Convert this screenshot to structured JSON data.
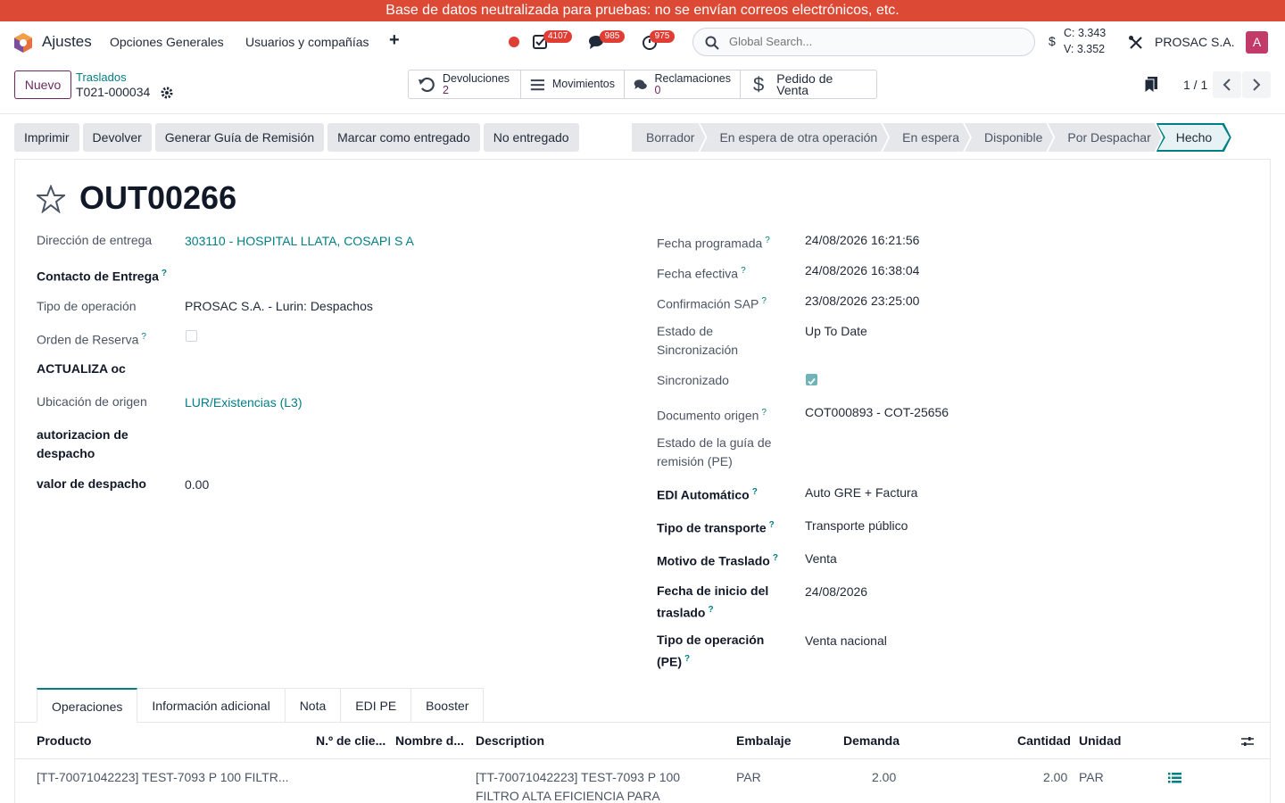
{
  "banner": "Base de datos neutralizada para pruebas: no se envían correos electrónicos, etc.",
  "navbar": {
    "app_name": "Ajustes",
    "menus": [
      "Opciones Generales",
      "Usuarios y compañías"
    ],
    "badges": {
      "activities": "4107",
      "messages": "985",
      "timers": "975"
    },
    "search_placeholder": "Global Search...",
    "currency_c": "C: 3.343",
    "currency_v": "V: 3.352",
    "currency_symbol": "$",
    "company": "PROSAC S.A.",
    "avatar_letter": "A",
    "accent": "#017e84",
    "brand": "#6b2a5f"
  },
  "control": {
    "new_label": "Nuevo",
    "breadcrumb_parent": "Traslados",
    "breadcrumb_current": "T021-000034",
    "smart_buttons": [
      {
        "label": "Devoluciones",
        "count": "2",
        "icon": "undo-icon"
      },
      {
        "label": "Movimientos",
        "count": "",
        "icon": "list-icon"
      },
      {
        "label": "Reclamaciones",
        "count": "0",
        "icon": "comments-icon"
      },
      {
        "label": "Pedido de Venta",
        "count": "",
        "icon": "dollar-icon"
      }
    ],
    "pager": "1 / 1"
  },
  "actions": [
    "Imprimir",
    "Devolver",
    "Generar Guía de Remisión",
    "Marcar como entregado",
    "No entregado"
  ],
  "statusbar": [
    "Borrador",
    "En espera de otra operación",
    "En espera",
    "Disponible",
    "Por Despachar",
    "Hecho"
  ],
  "record": {
    "title": "OUT00266",
    "left_fields": [
      {
        "label": "Dirección de entrega",
        "value": "303110 - HOSPITAL LLATA, COSAPI S A"
      },
      {
        "label": "Contacto de Entrega",
        "value": ""
      },
      {
        "label": "Tipo de operación",
        "value": "PROSAC S.A. - Lurin: Despachos"
      },
      {
        "label": "Orden de Reserva",
        "value": ""
      },
      {
        "label": "ACTUALIZA oc",
        "value": ""
      },
      {
        "label": "Ubicación de origen",
        "value": "LUR/Existencias (L3)"
      },
      {
        "label": "autorizacion de despacho",
        "value": ""
      },
      {
        "label": "valor de despacho",
        "value": "0.00"
      }
    ],
    "right_fields": [
      {
        "label": "Fecha programada",
        "value": "24/08/2026 16:21:56"
      },
      {
        "label": "Fecha efectiva",
        "value": "24/08/2026 16:38:04"
      },
      {
        "label": "Confirmación SAP",
        "value": "23/08/2026 23:25:00"
      },
      {
        "label": "Estado de Sincronización",
        "value": "Up To Date"
      },
      {
        "label": "Sincronizado",
        "value": ""
      },
      {
        "label": "Documento origen",
        "value": "COT000893 - COT-25656"
      },
      {
        "label": "Estado de la guía de remisión (PE)",
        "value": ""
      },
      {
        "label": "EDI Automático",
        "value": "Auto GRE + Factura"
      },
      {
        "label": "Tipo de transporte",
        "value": "Transporte público"
      },
      {
        "label": "Motivo de Traslado",
        "value": "Venta"
      },
      {
        "label": "Fecha de inicio del traslado",
        "value": "24/08/2026"
      },
      {
        "label": "Tipo de operación (PE)",
        "value": "Venta nacional"
      }
    ]
  },
  "tabs": [
    "Operaciones",
    "Información adicional",
    "Nota",
    "EDI PE",
    "Booster"
  ],
  "table": {
    "headers": [
      "Producto",
      "N.º de clie...",
      "Nombre d...",
      "Description",
      "Embalaje",
      "Demanda",
      "Cantidad",
      "Unidad"
    ],
    "rows": [
      {
        "product": "[TT-70071042223] TEST-7093 P 100 FILTR...",
        "description_1": "[TT-70071042223] TEST-7093 P 100",
        "description_2": "FILTRO ALTA EFICIENCIA PARA",
        "packaging": "PAR",
        "demand": "2.00",
        "quantity": "2.00",
        "unit": "PAR"
      }
    ]
  }
}
